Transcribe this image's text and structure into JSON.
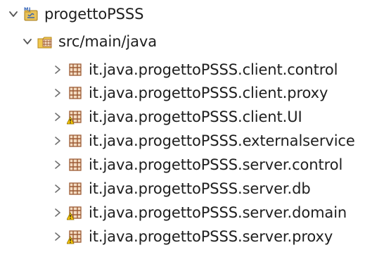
{
  "project": {
    "name": "progettoPSSS",
    "icon": "java-project-icon",
    "expanded": true
  },
  "source_folder": {
    "name": "src/main/java",
    "icon": "source-folder-icon",
    "expanded": true
  },
  "packages": [
    {
      "name": "it.java.progettoPSSS.client.control",
      "icon": "package-icon",
      "warning": false
    },
    {
      "name": "it.java.progettoPSSS.client.proxy",
      "icon": "package-icon",
      "warning": false
    },
    {
      "name": "it.java.progettoPSSS.client.UI",
      "icon": "package-warning-icon",
      "warning": true
    },
    {
      "name": "it.java.progettoPSSS.externalservice",
      "icon": "package-icon",
      "warning": false
    },
    {
      "name": "it.java.progettoPSSS.server.control",
      "icon": "package-icon",
      "warning": false
    },
    {
      "name": "it.java.progettoPSSS.server.db",
      "icon": "package-icon",
      "warning": false
    },
    {
      "name": "it.java.progettoPSSS.server.domain",
      "icon": "package-warning-icon",
      "warning": true
    },
    {
      "name": "it.java.progettoPSSS.server.proxy",
      "icon": "package-warning-icon",
      "warning": true
    }
  ],
  "colors": {
    "text": "#1e1e1e",
    "chevron": "#6f6f6f",
    "package": "#9c5a34",
    "package_fill": "#f3dcc2",
    "folder": "#e7b94a",
    "warning": "#f5c400",
    "java_blue": "#2f5fb5"
  }
}
